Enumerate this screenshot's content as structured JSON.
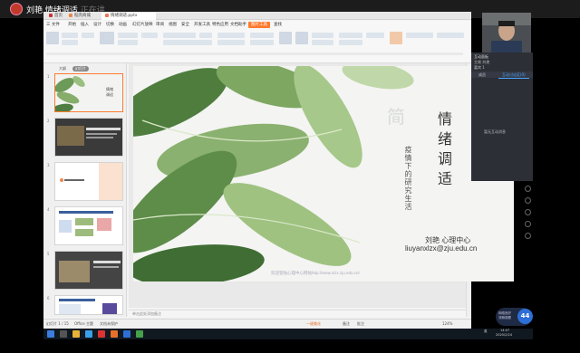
{
  "presenter": {
    "name": "刘艳",
    "status": "情绪调适",
    "suffix": "正在讲"
  },
  "tabs": [
    {
      "label": "首页"
    },
    {
      "label": "稻壳商城"
    },
    {
      "label": "情绪调适.pptx"
    }
  ],
  "menu": {
    "items": [
      "三 文件",
      "开始",
      "插入",
      "设计",
      "切换",
      "动画",
      "幻灯片放映",
      "审阅",
      "视图",
      "安全",
      "开发工具",
      "特色应用",
      "文档助手",
      "图片工具",
      "查找"
    ],
    "active_index": 13
  },
  "left_pane": {
    "tab_outline": "大纲",
    "tab_slides": "幻灯片",
    "slide_numbers": [
      "1",
      "2",
      "3",
      "4",
      "5",
      "6"
    ]
  },
  "slide": {
    "bg_char": "简",
    "title": "情绪调适",
    "subtitle": "疫情下的研究生活",
    "name": "刘艳 心理中心",
    "email": "liuyanxlzx@zju.edu.cn",
    "footer": "欢迎登陆心理中心网站http://www.xlzx.zju.edu.cn/"
  },
  "notes_placeholder": "单击此处添加备注",
  "status_bar": {
    "slide_count": "幻灯片 1 / 15",
    "theme": "Office 主题",
    "protect": "文档未保护",
    "notes": "备注",
    "comments": "批注",
    "beautify": "一键美化",
    "zoom": "124%"
  },
  "meeting": {
    "header": "互动面板",
    "line1": "主席 刘艳",
    "line2": "嘉宾 1",
    "tab_members": "成员",
    "tab_chat": "互动讨论区(0)",
    "empty": "暂无互动消息"
  },
  "badge": {
    "line1": "网络良好",
    "line2": "流畅观看",
    "number": "44"
  },
  "taskbar": {
    "time": "14:07",
    "date": "2020/2/24",
    "lang": "英"
  }
}
